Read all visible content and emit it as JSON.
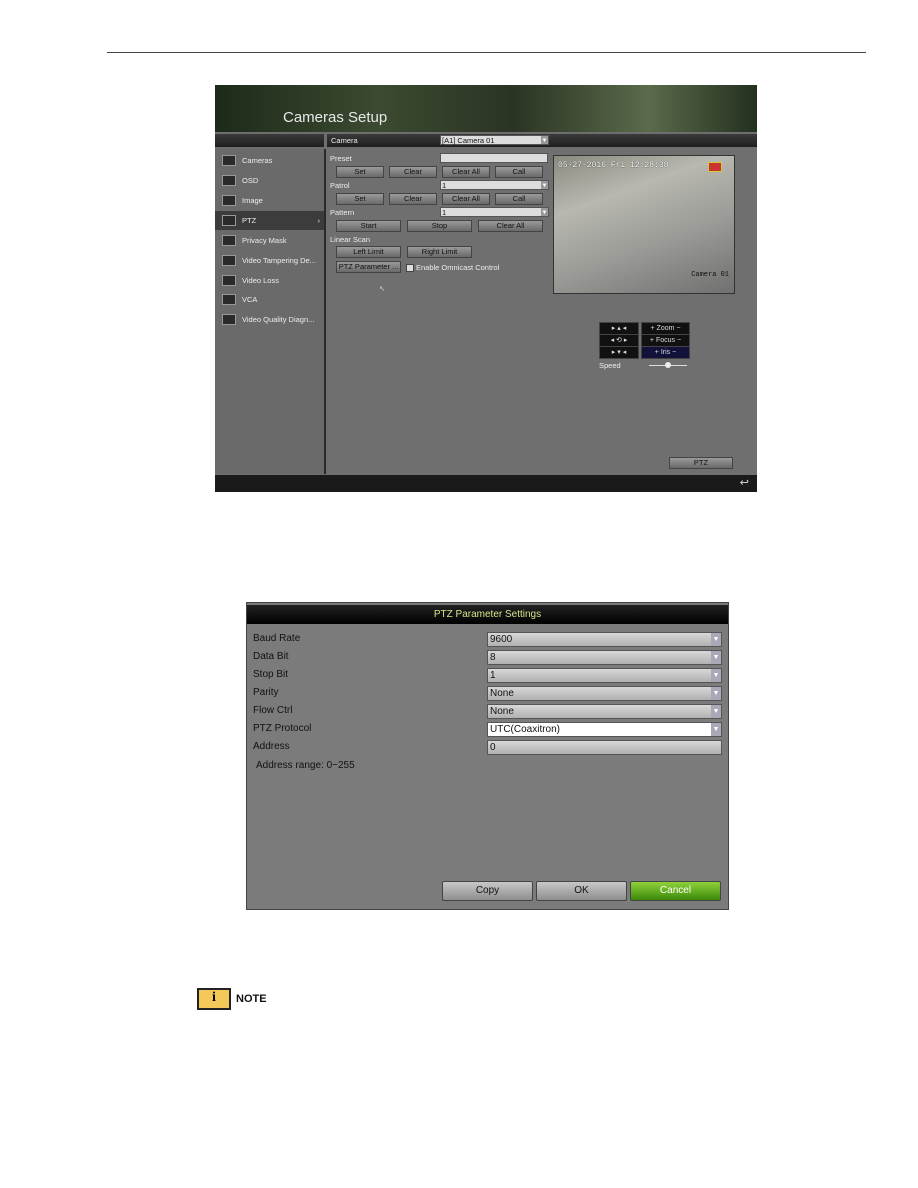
{
  "screen1": {
    "title": "Cameras Setup",
    "camera_label": "Camera",
    "camera_value": "[A1] Camera 01",
    "sidebar": [
      {
        "label": "Cameras"
      },
      {
        "label": "OSD"
      },
      {
        "label": "Image"
      },
      {
        "label": "PTZ",
        "selected": true
      },
      {
        "label": "Privacy Mask"
      },
      {
        "label": "Video Tampering De..."
      },
      {
        "label": "Video Loss"
      },
      {
        "label": "VCA"
      },
      {
        "label": "Video Quality Diagn..."
      }
    ],
    "preset_label": "Preset",
    "preset_value": "",
    "preset_buttons": [
      "Set",
      "Clear",
      "Clear All",
      "Call"
    ],
    "patrol_label": "Patrol",
    "patrol_value": "1",
    "patrol_buttons": [
      "Set",
      "Clear",
      "Clear All",
      "Call"
    ],
    "pattern_label": "Pattern",
    "pattern_value": "1",
    "pattern_buttons": [
      "Start",
      "Stop",
      "Clear All"
    ],
    "linear_scan_label": "Linear Scan",
    "left_limit": "Left Limit",
    "right_limit": "Right Limit",
    "ptz_parameter": "PTZ Parameter ...",
    "omnicast_label": "Enable Omnicast Control",
    "omnicast_checked": false,
    "video_timestamp": "05-27-2016 Fri 12:28:38",
    "video_camera_name": "Camera 01",
    "zoom_label": "Zoom",
    "focus_label": "Focus",
    "iris_label": "Iris",
    "speed_label": "Speed",
    "speed_level": 0.5,
    "ptz_button": "PTZ"
  },
  "screen2": {
    "title": "PTZ Parameter Settings",
    "rows": [
      {
        "label": "Baud Rate",
        "value": "9600"
      },
      {
        "label": "Data Bit",
        "value": "8"
      },
      {
        "label": "Stop Bit",
        "value": "1"
      },
      {
        "label": "Parity",
        "value": "None"
      },
      {
        "label": "Flow Ctrl",
        "value": "None"
      },
      {
        "label": "PTZ Protocol",
        "value": "UTC(Coaxitron)"
      },
      {
        "label": "Address",
        "value": "0"
      }
    ],
    "address_range": "Address range: 0~255",
    "copy": "Copy",
    "ok": "OK",
    "cancel": "Cancel"
  },
  "note": {
    "label": "NOTE"
  }
}
